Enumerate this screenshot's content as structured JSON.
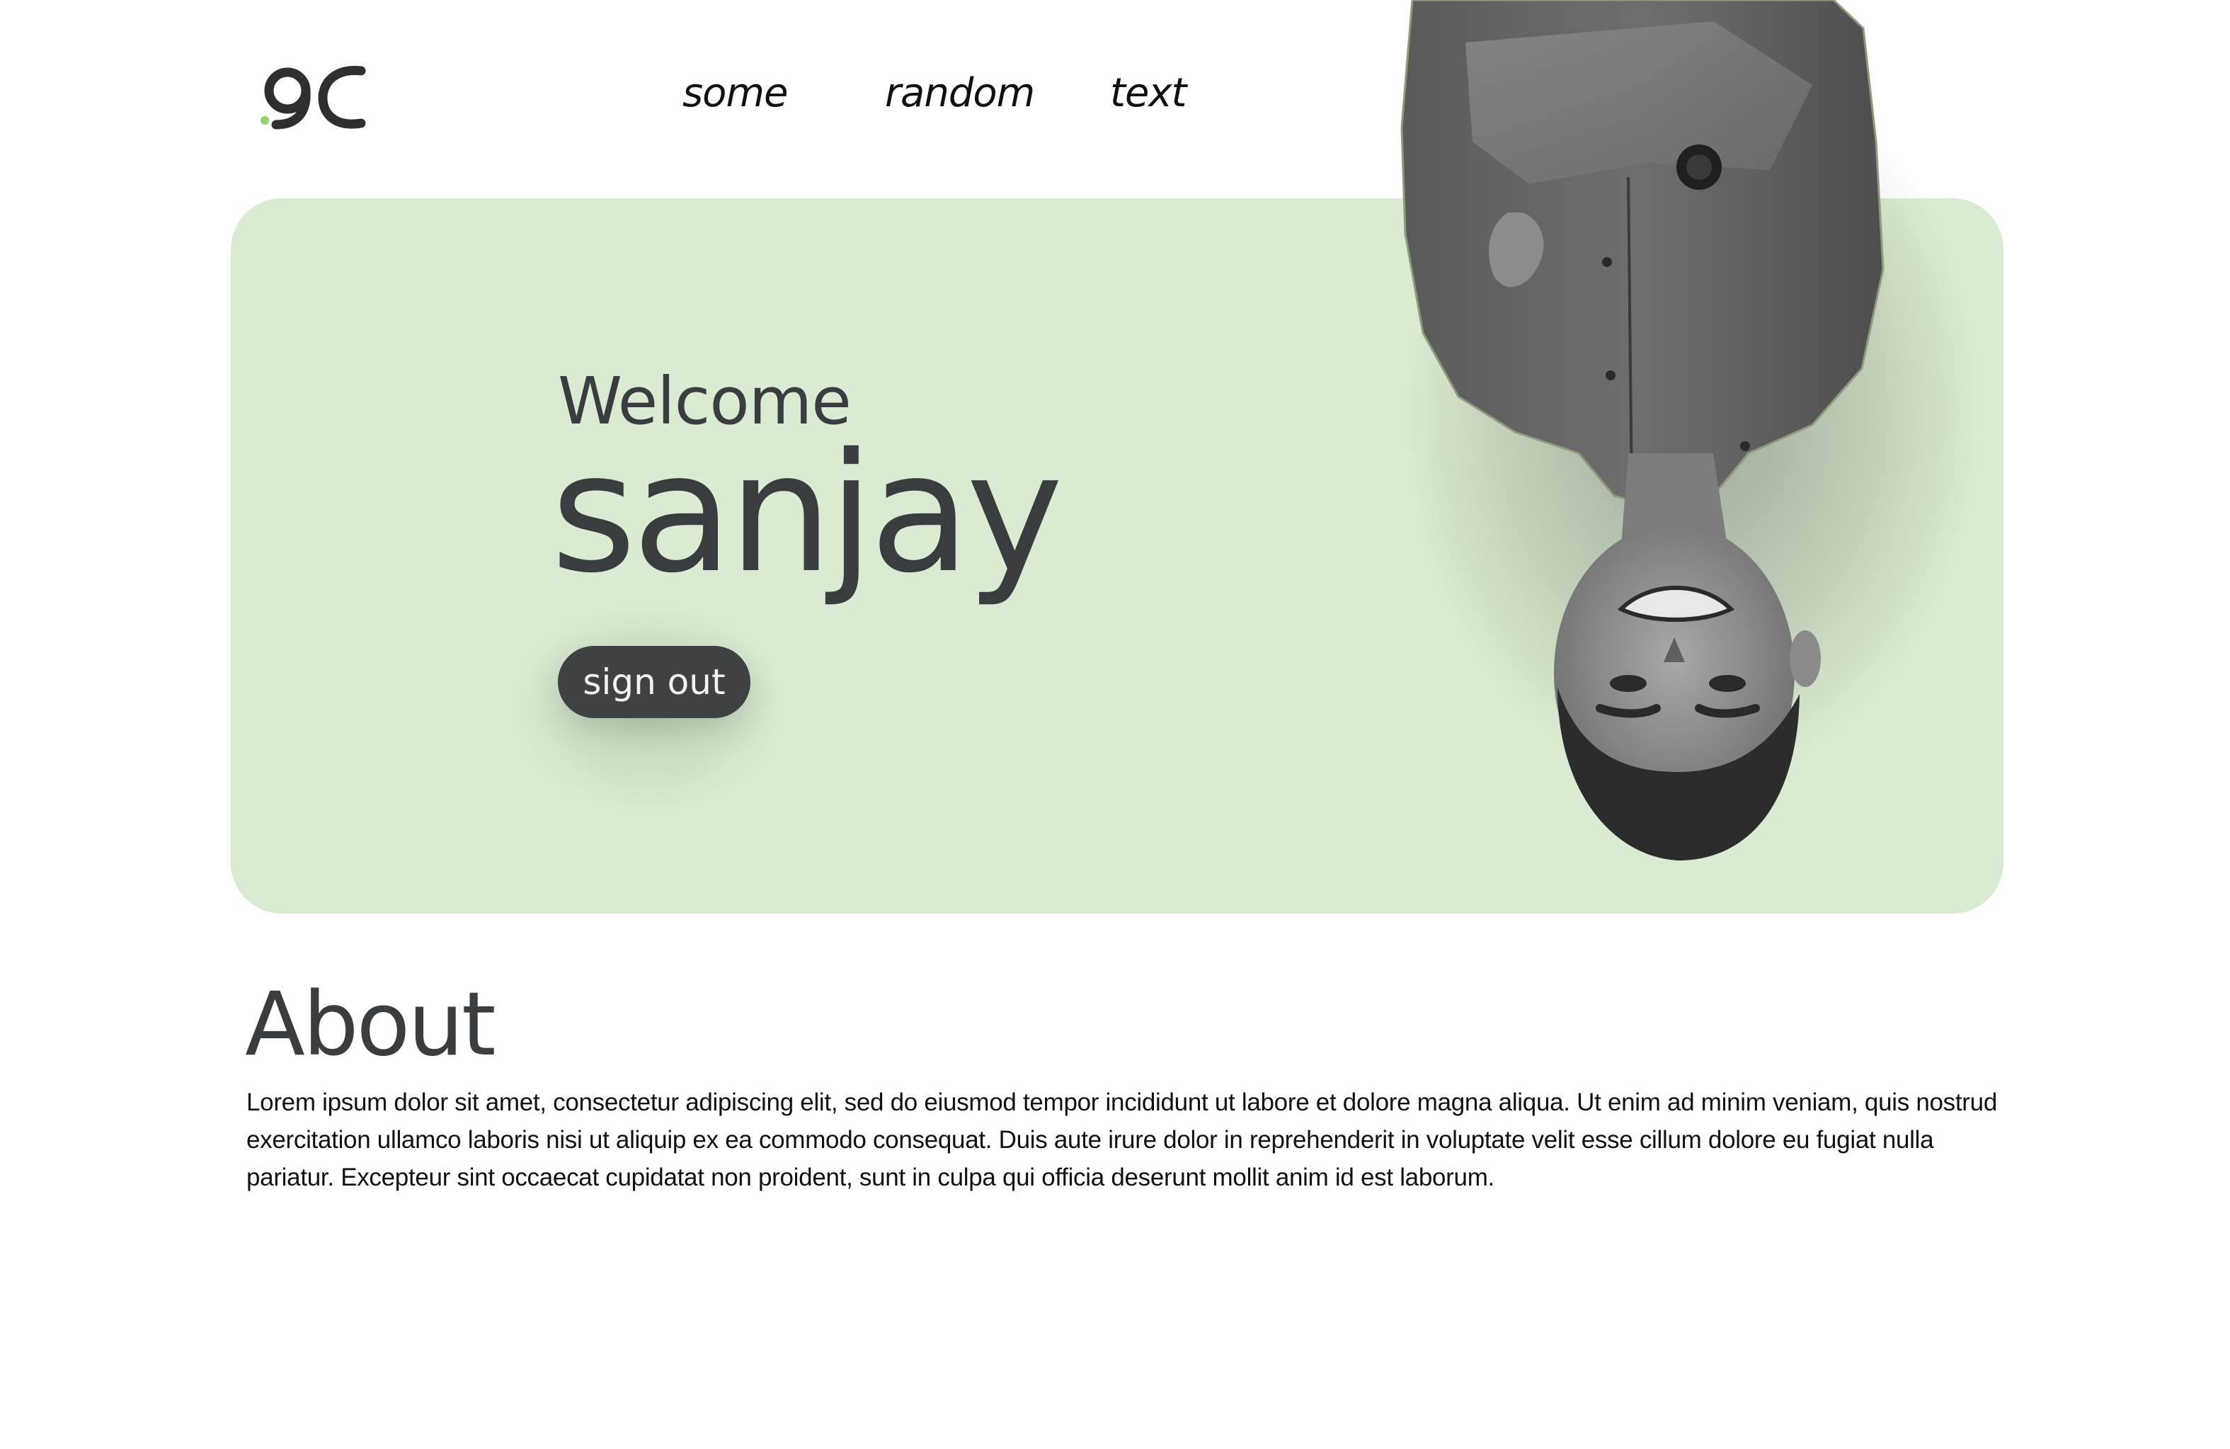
{
  "header": {
    "logo_text": "9C",
    "nav": [
      {
        "label": "some"
      },
      {
        "label": "random"
      },
      {
        "label": "text"
      }
    ]
  },
  "hero": {
    "greeting": "Welcome",
    "name": "sanjay",
    "signout_label": "sign out",
    "background_color": "#d9ebd0"
  },
  "about": {
    "title": "About",
    "body": "Lorem ipsum dolor sit amet, consectetur adipiscing elit, sed do eiusmod tempor incididunt ut labore et dolore magna aliqua. Ut enim ad minim veniam, quis nostrud exercitation ullamco laboris nisi ut aliquip ex ea commodo consequat. Duis aute irure dolor in reprehenderit in voluptate velit esse cillum dolore eu fugiat nulla pariatur. Excepteur sint occaecat cupidatat non proident, sunt in culpa qui officia deserunt mollit anim id est laborum."
  },
  "colors": {
    "text_dark": "#3a3d3f",
    "button_bg": "#3f4244",
    "accent_dot": "#8fd46f"
  }
}
